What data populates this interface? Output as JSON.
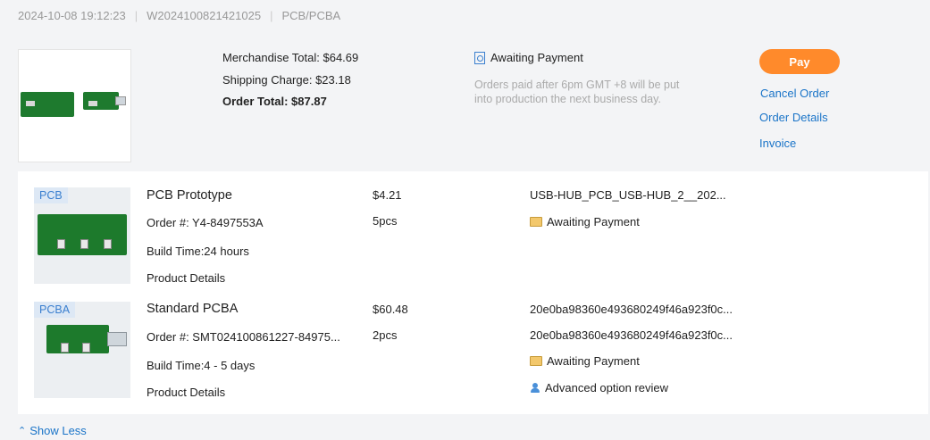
{
  "header": {
    "datetime": "2024-10-08 19:12:23",
    "order_id": "W2024100821421025",
    "category": "PCB/PCBA"
  },
  "summary": {
    "merchandise_total": "Merchandise Total: $64.69",
    "shipping_charge": "Shipping Charge: $23.18",
    "order_total": "Order Total: $87.87",
    "status": "Awaiting Payment",
    "note": "Orders paid after 6pm GMT +8 will be put into production the next business day.",
    "pay_label": "Pay",
    "cancel_label": "Cancel Order",
    "details_label": "Order Details",
    "invoice_label": "Invoice"
  },
  "items": [
    {
      "tag": "PCB",
      "name": "PCB Prototype",
      "order_no": "Order #:  Y4-8497553A",
      "build_time": "Build Time:24 hours",
      "details_link": "Product Details",
      "price": "$4.21",
      "qty": "5pcs",
      "file": "USB-HUB_PCB_USB-HUB_2__202...",
      "status": "Awaiting Payment"
    },
    {
      "tag": "PCBA",
      "name": "Standard PCBA",
      "order_no": "Order #:  SMT024100861227-84975...",
      "build_time": "Build Time:4 - 5 days",
      "details_link": "Product Details",
      "price": "$60.48",
      "qty": "2pcs",
      "file1": "20e0ba98360e493680249f46a923f0c...",
      "file2": "20e0ba98360e493680249f46a923f0c...",
      "status": "Awaiting Payment",
      "review": "Advanced option review"
    }
  ],
  "footer": {
    "show_less": "Show Less"
  },
  "colors": {
    "accent": "#ff8a2b",
    "link": "#1a74c8",
    "board": "#1d7a2c"
  }
}
